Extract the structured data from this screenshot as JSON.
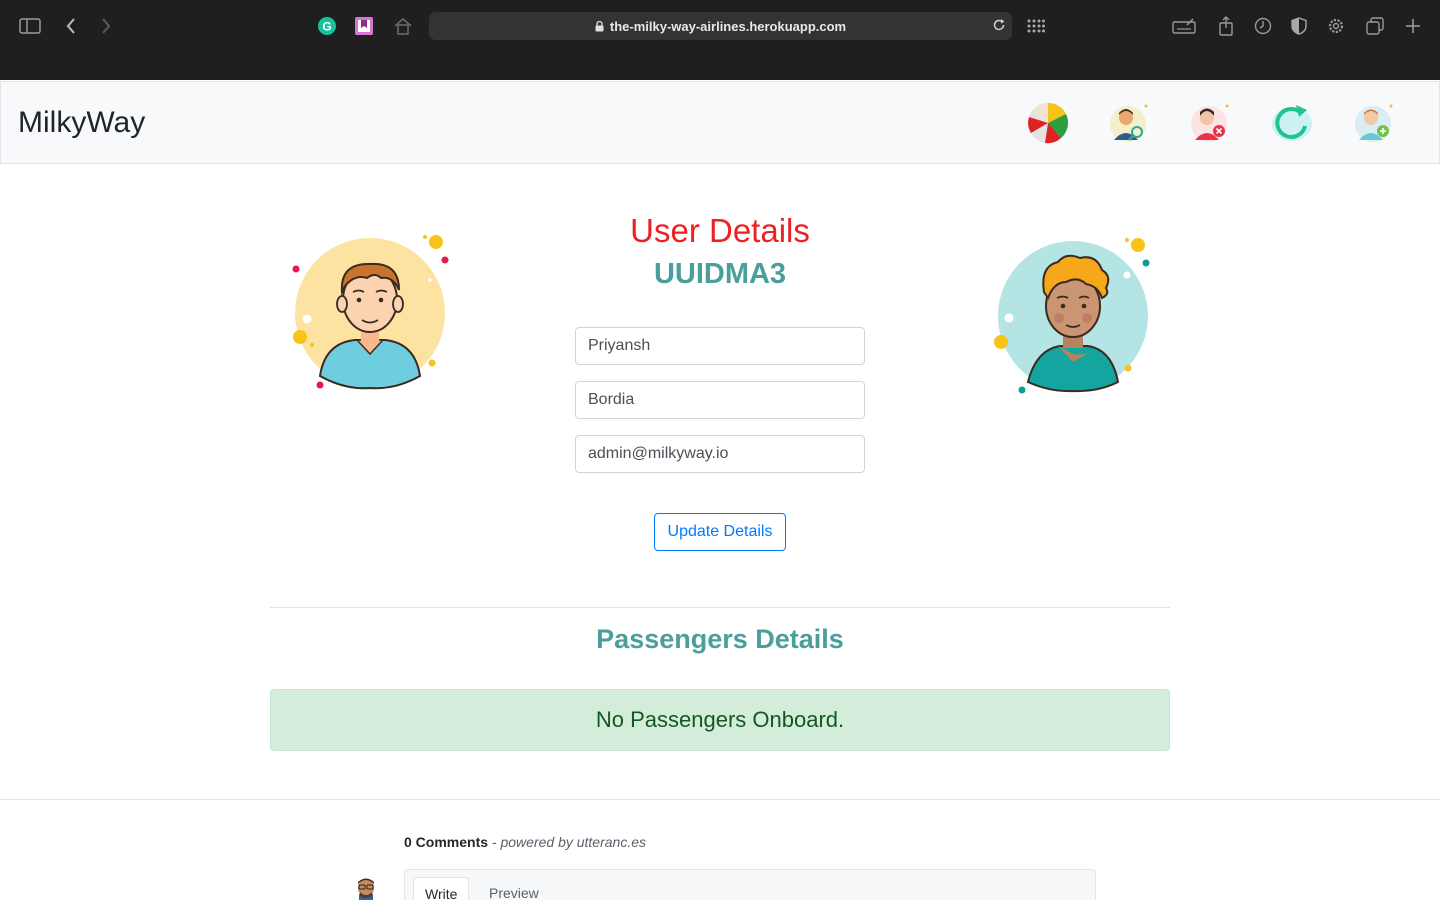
{
  "browser": {
    "url": "the-milky-way-airlines.herokuapp.com",
    "icons": [
      "sidebar-icon",
      "back-icon",
      "forward-icon",
      "grammarly-icon",
      "bookmark-extension-icon",
      "home-icon",
      "reload-icon",
      "grid-icon",
      "keyboard-icon",
      "share-icon",
      "history-icon",
      "shield-icon",
      "gear-icon",
      "tabs-icon",
      "new-tab-icon"
    ]
  },
  "navbar": {
    "brand": "MilkyWay",
    "icons": [
      "stats-pie-icon",
      "search-user-icon",
      "delete-user-icon",
      "refresh-icon",
      "add-user-icon"
    ]
  },
  "main": {
    "title": "User Details",
    "uuid": "UUIDMA3",
    "first_name": "Priyansh",
    "last_name": "Bordia",
    "email": "admin@milkyway.io",
    "update_label": "Update Details",
    "passengers_title": "Passengers Details",
    "no_passengers": "No Passengers Onboard."
  },
  "comments": {
    "count_label": "0 Comments",
    "powered": " - powered by utteranc.es",
    "tab_write": "Write",
    "tab_preview": "Preview"
  },
  "colors": {
    "title_red": "#ec2222",
    "teal": "#4a9e9c",
    "primary": "#007bff",
    "alert_bg": "#d4edda",
    "alert_text": "#155724"
  }
}
